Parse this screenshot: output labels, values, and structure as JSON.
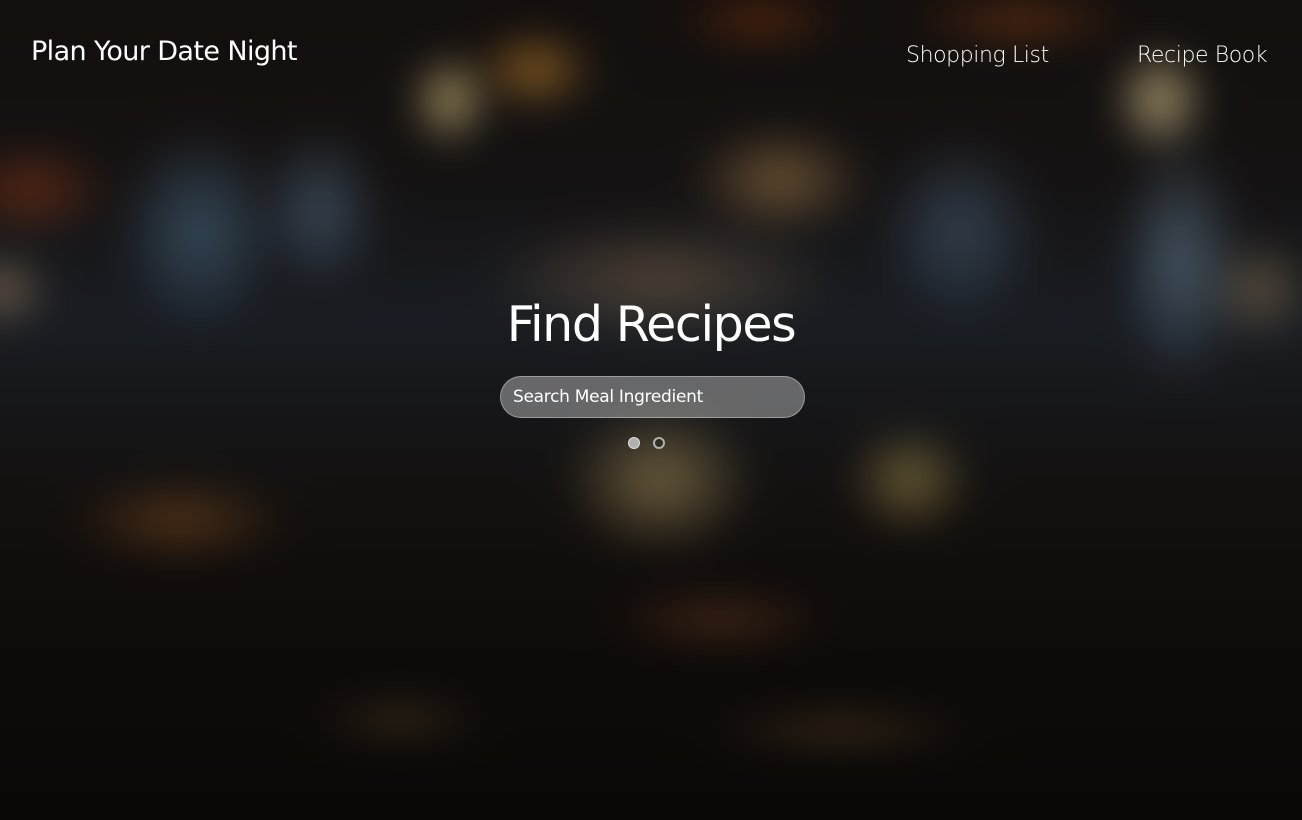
{
  "nav": {
    "brand": "Plan Your Date Night",
    "links": [
      {
        "label": "Shopping List"
      },
      {
        "label": "Recipe Book"
      }
    ]
  },
  "hero": {
    "title": "Find Recipes",
    "search": {
      "placeholder": "Search Meal Ingredient",
      "value": ""
    },
    "carousel": {
      "slide_count": 2,
      "active_index": 0
    }
  },
  "colors": {
    "text": "#ffffff",
    "search_bg": "#aaaaaa"
  }
}
